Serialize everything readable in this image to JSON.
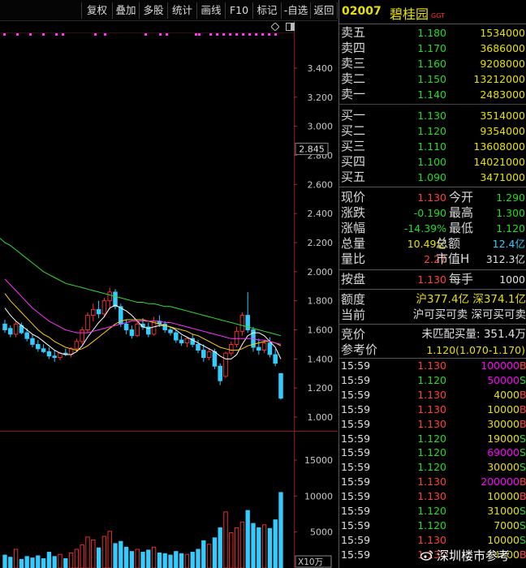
{
  "toolbar": {
    "buttons": [
      "复权",
      "叠加",
      "多股",
      "统计",
      "画线",
      "F10",
      "标记",
      "-自选",
      "返回"
    ]
  },
  "stock": {
    "code": "02007",
    "name": "碧桂园",
    "tag": "GGT"
  },
  "order_book": {
    "asks": [
      {
        "label": "卖五",
        "price": "1.180",
        "volume": "1534000"
      },
      {
        "label": "卖四",
        "price": "1.170",
        "volume": "3686000"
      },
      {
        "label": "卖三",
        "price": "1.160",
        "volume": "9208000"
      },
      {
        "label": "卖二",
        "price": "1.150",
        "volume": "13212000"
      },
      {
        "label": "卖一",
        "price": "1.140",
        "volume": "2483000"
      }
    ],
    "bids": [
      {
        "label": "买一",
        "price": "1.130",
        "volume": "3514000"
      },
      {
        "label": "买二",
        "price": "1.120",
        "volume": "9354000"
      },
      {
        "label": "买三",
        "price": "1.110",
        "volume": "13608000"
      },
      {
        "label": "买四",
        "price": "1.100",
        "volume": "14021000"
      },
      {
        "label": "买五",
        "price": "1.090",
        "volume": "3471000"
      }
    ]
  },
  "quote": {
    "current_label": "现价",
    "current": "1.130",
    "open_label": "今开",
    "open": "1.290",
    "change_label": "涨跌",
    "change": "-0.190",
    "high_label": "最高",
    "high": "1.300",
    "pct_label": "涨幅",
    "pct": "-14.39%",
    "low_label": "最低",
    "low": "1.120",
    "volume_label": "总量",
    "volume": "10.49亿",
    "amount_label": "总额",
    "amount": "12.4亿",
    "ratio_label": "量比",
    "ratio": "2.27",
    "mktcap_label": "市值H",
    "mktcap": "312.3亿",
    "settle_label": "按盘",
    "settle": "1.130",
    "lot_label": "每手",
    "lot": "1000"
  },
  "quota": {
    "label": "额度",
    "value": "沪377.4亿 深374.1亿",
    "current_label": "当前",
    "current": "沪可买可卖 深可买可卖"
  },
  "auction": {
    "label": "竞价",
    "value": "未匹配买量: 351.4万",
    "ref_label": "参考价",
    "ref": "1.120(1.070-1.170)"
  },
  "trades": [
    {
      "time": "15:59",
      "price": "1.130",
      "volume": "100000",
      "side": "B"
    },
    {
      "time": "15:59",
      "price": "1.120",
      "volume": "50000",
      "side": "S"
    },
    {
      "time": "15:59",
      "price": "1.130",
      "volume": "4000",
      "side": "B"
    },
    {
      "time": "15:59",
      "price": "1.130",
      "volume": "10000",
      "side": "B"
    },
    {
      "time": "15:59",
      "price": "1.130",
      "volume": "30000",
      "side": "B"
    },
    {
      "time": "15:59",
      "price": "1.120",
      "volume": "19000",
      "side": "S"
    },
    {
      "time": "15:59",
      "price": "1.120",
      "volume": "69000",
      "side": "S"
    },
    {
      "time": "15:59",
      "price": "1.120",
      "volume": "30000",
      "side": "S"
    },
    {
      "time": "15:59",
      "price": "1.130",
      "volume": "200000",
      "side": "B"
    },
    {
      "time": "15:59",
      "price": "1.130",
      "volume": "10000",
      "side": "B"
    },
    {
      "time": "15:59",
      "price": "1.120",
      "volume": "31000",
      "side": "S"
    },
    {
      "time": "15:59",
      "price": "1.120",
      "volume": "7000",
      "side": "S"
    },
    {
      "time": "15:59",
      "price": "1.130",
      "volume": "10000",
      "side": "S"
    },
    {
      "time": "15:59",
      "price": "1.130",
      "volume": "14000",
      "side": "B"
    }
  ],
  "colors": {
    "up": "#ff3030",
    "down": "#22dd22",
    "flat": "#e0e0e0",
    "bar_down": "#33ccff",
    "bar_up": "#ff3333",
    "ma5": "#ffffff",
    "ma10": "#ffd000",
    "ma20": "#ff33ff",
    "ma60": "#33dd33",
    "grid": "#7a1a1a",
    "axis_text": "#c8c8c8"
  },
  "chart_data": {
    "type": "candlestick",
    "price_axis": {
      "range": [
        0.95,
        3.5
      ],
      "ticks": [
        "3.400",
        "3.200",
        "3.000",
        "2.800",
        "2.600",
        "2.400",
        "2.200",
        "2.000",
        "1.800",
        "1.600",
        "1.400",
        "1.200",
        "1.000"
      ],
      "marker": "2.845"
    },
    "volume_axis": {
      "range": [
        0,
        18500
      ],
      "ticks": [
        "15000",
        "10000",
        "5000"
      ],
      "unit": "X10万"
    },
    "candles": [
      {
        "o": 1.64,
        "h": 1.67,
        "l": 1.58,
        "c": 1.6
      },
      {
        "o": 1.61,
        "h": 1.63,
        "l": 1.55,
        "c": 1.57
      },
      {
        "o": 1.57,
        "h": 1.66,
        "l": 1.55,
        "c": 1.64
      },
      {
        "o": 1.63,
        "h": 1.65,
        "l": 1.57,
        "c": 1.58
      },
      {
        "o": 1.58,
        "h": 1.61,
        "l": 1.52,
        "c": 1.54
      },
      {
        "o": 1.54,
        "h": 1.57,
        "l": 1.48,
        "c": 1.5
      },
      {
        "o": 1.5,
        "h": 1.53,
        "l": 1.45,
        "c": 1.47
      },
      {
        "o": 1.47,
        "h": 1.5,
        "l": 1.44,
        "c": 1.45
      },
      {
        "o": 1.45,
        "h": 1.48,
        "l": 1.4,
        "c": 1.42
      },
      {
        "o": 1.42,
        "h": 1.46,
        "l": 1.38,
        "c": 1.41
      },
      {
        "o": 1.41,
        "h": 1.45,
        "l": 1.39,
        "c": 1.44
      },
      {
        "o": 1.44,
        "h": 1.47,
        "l": 1.42,
        "c": 1.43
      },
      {
        "o": 1.43,
        "h": 1.48,
        "l": 1.41,
        "c": 1.47
      },
      {
        "o": 1.47,
        "h": 1.54,
        "l": 1.45,
        "c": 1.52
      },
      {
        "o": 1.52,
        "h": 1.62,
        "l": 1.5,
        "c": 1.6
      },
      {
        "o": 1.6,
        "h": 1.72,
        "l": 1.58,
        "c": 1.7
      },
      {
        "o": 1.7,
        "h": 1.78,
        "l": 1.66,
        "c": 1.74
      },
      {
        "o": 1.74,
        "h": 1.8,
        "l": 1.68,
        "c": 1.71
      },
      {
        "o": 1.71,
        "h": 1.82,
        "l": 1.69,
        "c": 1.8
      },
      {
        "o": 1.8,
        "h": 1.89,
        "l": 1.74,
        "c": 1.86
      },
      {
        "o": 1.86,
        "h": 1.88,
        "l": 1.74,
        "c": 1.76
      },
      {
        "o": 1.76,
        "h": 1.78,
        "l": 1.62,
        "c": 1.64
      },
      {
        "o": 1.64,
        "h": 1.67,
        "l": 1.57,
        "c": 1.6
      },
      {
        "o": 1.6,
        "h": 1.63,
        "l": 1.54,
        "c": 1.56
      },
      {
        "o": 1.56,
        "h": 1.66,
        "l": 1.55,
        "c": 1.64
      },
      {
        "o": 1.64,
        "h": 1.68,
        "l": 1.6,
        "c": 1.62
      },
      {
        "o": 1.62,
        "h": 1.65,
        "l": 1.55,
        "c": 1.57
      },
      {
        "o": 1.57,
        "h": 1.69,
        "l": 1.56,
        "c": 1.66
      },
      {
        "o": 1.66,
        "h": 1.7,
        "l": 1.62,
        "c": 1.64
      },
      {
        "o": 1.64,
        "h": 1.66,
        "l": 1.58,
        "c": 1.6
      },
      {
        "o": 1.6,
        "h": 1.62,
        "l": 1.56,
        "c": 1.58
      },
      {
        "o": 1.58,
        "h": 1.6,
        "l": 1.51,
        "c": 1.53
      },
      {
        "o": 1.53,
        "h": 1.56,
        "l": 1.49,
        "c": 1.51
      },
      {
        "o": 1.51,
        "h": 1.55,
        "l": 1.48,
        "c": 1.54
      },
      {
        "o": 1.54,
        "h": 1.57,
        "l": 1.48,
        "c": 1.5
      },
      {
        "o": 1.5,
        "h": 1.53,
        "l": 1.44,
        "c": 1.46
      },
      {
        "o": 1.46,
        "h": 1.5,
        "l": 1.38,
        "c": 1.41
      },
      {
        "o": 1.41,
        "h": 1.47,
        "l": 1.39,
        "c": 1.45
      },
      {
        "o": 1.45,
        "h": 1.47,
        "l": 1.33,
        "c": 1.35
      },
      {
        "o": 1.35,
        "h": 1.37,
        "l": 1.22,
        "c": 1.25
      },
      {
        "o": 1.28,
        "h": 1.45,
        "l": 1.27,
        "c": 1.44
      },
      {
        "o": 1.44,
        "h": 1.52,
        "l": 1.42,
        "c": 1.5
      },
      {
        "o": 1.5,
        "h": 1.62,
        "l": 1.48,
        "c": 1.59
      },
      {
        "o": 1.59,
        "h": 1.72,
        "l": 1.56,
        "c": 1.7
      },
      {
        "o": 1.7,
        "h": 1.86,
        "l": 1.58,
        "c": 1.6
      },
      {
        "o": 1.6,
        "h": 1.62,
        "l": 1.45,
        "c": 1.48
      },
      {
        "o": 1.48,
        "h": 1.54,
        "l": 1.43,
        "c": 1.46
      },
      {
        "o": 1.46,
        "h": 1.53,
        "l": 1.44,
        "c": 1.51
      },
      {
        "o": 1.51,
        "h": 1.55,
        "l": 1.41,
        "c": 1.43
      },
      {
        "o": 1.43,
        "h": 1.47,
        "l": 1.35,
        "c": 1.37
      },
      {
        "o": 1.3,
        "h": 1.3,
        "l": 1.12,
        "c": 1.13
      }
    ],
    "volumes": [
      1800,
      1500,
      2600,
      1200,
      1600,
      1400,
      1700,
      1300,
      2200,
      1600,
      1900,
      1300,
      2100,
      2600,
      3200,
      4300,
      3900,
      2800,
      4400,
      5100,
      3400,
      3700,
      2900,
      2300,
      2600,
      2200,
      2500,
      2900,
      2100,
      2000,
      1800,
      2300,
      2000,
      1900,
      2200,
      2600,
      3800,
      3300,
      4200,
      5600,
      7800,
      4900,
      5600,
      6400,
      8000,
      6200,
      5600,
      6000,
      5500,
      6700,
      10500
    ],
    "ma_lines": [
      {
        "name": "MA5",
        "values": [
          1.75,
          1.7,
          1.66,
          1.63,
          1.6,
          1.57,
          1.55,
          1.52,
          1.49,
          1.46,
          1.44,
          1.43,
          1.43,
          1.45,
          1.49,
          1.55,
          1.6,
          1.65,
          1.69,
          1.75,
          1.77,
          1.75,
          1.73,
          1.7,
          1.66,
          1.62,
          1.61,
          1.62,
          1.63,
          1.63,
          1.62,
          1.6,
          1.57,
          1.55,
          1.53,
          1.51,
          1.49,
          1.47,
          1.45,
          1.42,
          1.4,
          1.4,
          1.43,
          1.5,
          1.56,
          1.58,
          1.58,
          1.56,
          1.52,
          1.48,
          1.4
        ]
      },
      {
        "name": "MA10",
        "values": [
          1.85,
          1.8,
          1.76,
          1.72,
          1.68,
          1.64,
          1.6,
          1.57,
          1.55,
          1.52,
          1.5,
          1.48,
          1.47,
          1.46,
          1.47,
          1.49,
          1.52,
          1.55,
          1.58,
          1.61,
          1.64,
          1.66,
          1.67,
          1.67,
          1.67,
          1.67,
          1.66,
          1.65,
          1.64,
          1.63,
          1.62,
          1.61,
          1.6,
          1.59,
          1.57,
          1.56,
          1.54,
          1.52,
          1.5,
          1.48,
          1.47,
          1.46,
          1.46,
          1.47,
          1.49,
          1.5,
          1.51,
          1.52,
          1.52,
          1.51,
          1.49
        ]
      },
      {
        "name": "MA20",
        "values": [
          1.95,
          1.91,
          1.87,
          1.83,
          1.79,
          1.75,
          1.72,
          1.69,
          1.66,
          1.64,
          1.62,
          1.6,
          1.59,
          1.58,
          1.58,
          1.58,
          1.59,
          1.6,
          1.61,
          1.62,
          1.63,
          1.64,
          1.65,
          1.66,
          1.66,
          1.66,
          1.66,
          1.66,
          1.66,
          1.65,
          1.65,
          1.64,
          1.63,
          1.62,
          1.61,
          1.6,
          1.59,
          1.58,
          1.57,
          1.56,
          1.55,
          1.54,
          1.54,
          1.54,
          1.54,
          1.54,
          1.53,
          1.53,
          1.52,
          1.51,
          1.5
        ]
      },
      {
        "name": "MA60",
        "values": [
          2.2,
          2.18,
          2.15,
          2.12,
          2.09,
          2.06,
          2.03,
          2.0,
          1.98,
          1.96,
          1.94,
          1.92,
          1.91,
          1.9,
          1.89,
          1.88,
          1.87,
          1.86,
          1.85,
          1.84,
          1.83,
          1.82,
          1.81,
          1.8,
          1.79,
          1.79,
          1.78,
          1.78,
          1.77,
          1.76,
          1.76,
          1.75,
          1.74,
          1.73,
          1.72,
          1.71,
          1.7,
          1.69,
          1.68,
          1.67,
          1.66,
          1.65,
          1.64,
          1.63,
          1.62,
          1.61,
          1.6,
          1.59,
          1.58,
          1.57,
          1.56
        ]
      }
    ]
  },
  "watermark": {
    "text": "深圳楼市参考"
  }
}
